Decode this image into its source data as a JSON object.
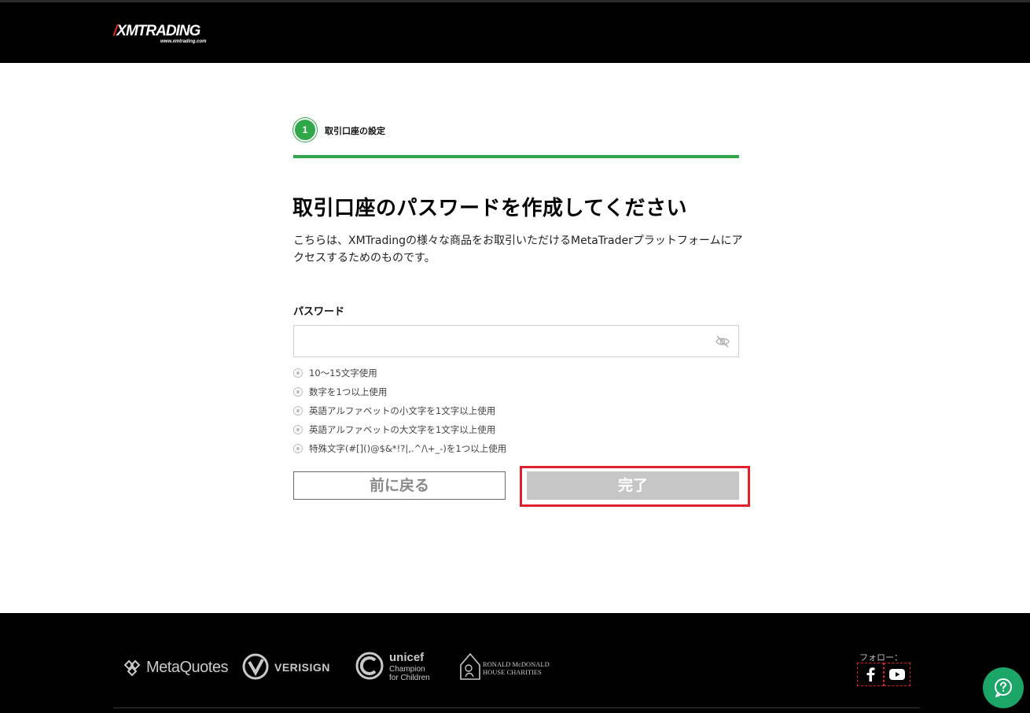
{
  "header": {
    "logo_text": "XMTRADING",
    "logo_mark": "/",
    "logo_url_text": "www.xmtrading.com"
  },
  "steps": {
    "current_number": "1",
    "current_label": "取引口座の設定",
    "progress_fraction": 1.0
  },
  "main": {
    "title": "取引口座のパスワードを作成してください",
    "description": "こちらは、XMTradingの様々な商品をお取引いただけるMetaTraderプラットフォームにアクセスするためのものです。"
  },
  "password_field": {
    "label": "パスワード",
    "value": "",
    "placeholder": "",
    "toggle_icon": "eye-slash-icon"
  },
  "requirements": [
    {
      "text": "10〜15文字使用"
    },
    {
      "text": "数字を1つ以上使用"
    },
    {
      "text": "英語アルファベットの小文字を1文字以上使用"
    },
    {
      "text": "英語アルファベットの大文字を1文字以上使用"
    },
    {
      "text": "特殊文字(#[]()@$&*!?|,.^/\\+_-)を1つ以上使用"
    }
  ],
  "buttons": {
    "back_label": "前に戻る",
    "complete_label": "完了"
  },
  "footer": {
    "partners": {
      "metaquotes": "MetaQuotes",
      "verisign": "VERISIGN",
      "unicef_name": "unicef",
      "unicef_line1": "Champion",
      "unicef_line2": "for Children",
      "rmhc_line1": "RONALD McDONALD",
      "rmhc_line2": "HOUSE CHARITIES"
    },
    "follow_label": "フォロー：",
    "social": [
      "facebook-icon",
      "youtube-icon"
    ]
  },
  "colors": {
    "brand_green": "#30a84a",
    "header_bg": "#000000",
    "highlight_red": "#e0202a",
    "disabled_button": "#c6c6c6",
    "help_green": "#1ba566"
  }
}
